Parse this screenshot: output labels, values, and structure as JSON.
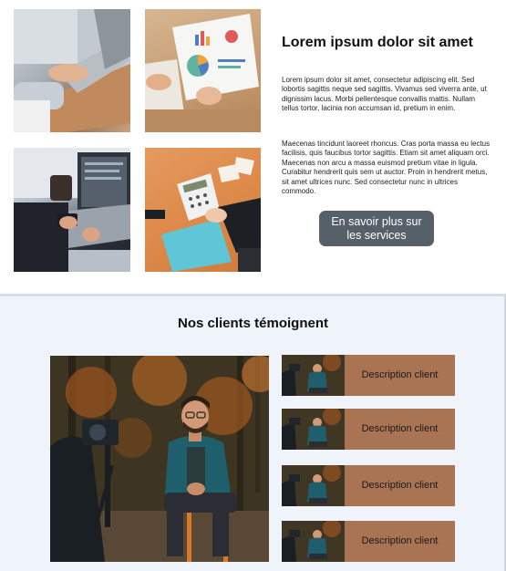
{
  "intro": {
    "title": "Lorem ipsum dolor sit amet",
    "paragraph1": "Lorem ipsum dolor sit amet, consectetur adipiscing elit. Sed lobortis sagittis neque sed sagittis. Vivamus sed viverra ante, ut dignissim lacus. Morbi pellentesque convallis mattis. Nullam tellus tortor, lacinia non accumsan id, pretium in enim.",
    "paragraph2": "Maecenas tincidunt laoreet rhoncus. Cras porta massa eu lectus facilisis, quis faucibus tortor sagittis. Etiam sit amet aliquam orci. Maecenas non arcu a massa euismod pretium vitae in ligula. Curabitur hendrerit quis sem ut auctor. Proin in hendrerit metus, sit amet ultrices nunc. Sed consectetur nunc in ultrices commodo.",
    "cta_label": "En savoir plus sur les services"
  },
  "gallery": [
    {
      "name": "photo-laptop-typing"
    },
    {
      "name": "photo-infographic-documents"
    },
    {
      "name": "photo-laptop-phone"
    },
    {
      "name": "photo-calculator-desk"
    }
  ],
  "testimonials": {
    "title": "Nos clients témoignent",
    "cards": [
      {
        "description": "Description client"
      },
      {
        "description": "Description client"
      },
      {
        "description": "Description client"
      },
      {
        "description": "Description client"
      }
    ]
  },
  "colors": {
    "button_bg": "#556069",
    "card_bg": "#a87454",
    "section_bg": "#eef4fa"
  }
}
